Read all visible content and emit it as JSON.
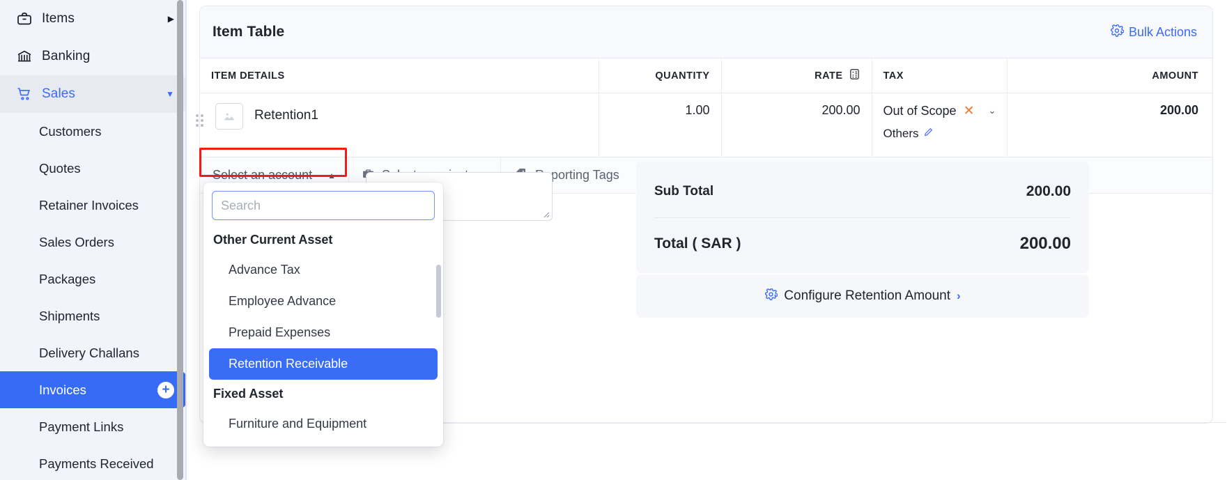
{
  "sidebar": {
    "top_items": [
      {
        "label": "Items",
        "icon": "briefcase-icon",
        "trailing": "caret-right"
      },
      {
        "label": "Banking",
        "icon": "bank-icon",
        "trailing": ""
      }
    ],
    "group": {
      "label": "Sales",
      "icon": "cart-icon",
      "trailing": "caret-down"
    },
    "sub_items": [
      {
        "label": "Customers",
        "selected": false
      },
      {
        "label": "Quotes",
        "selected": false
      },
      {
        "label": "Retainer Invoices",
        "selected": false
      },
      {
        "label": "Sales Orders",
        "selected": false
      },
      {
        "label": "Packages",
        "selected": false
      },
      {
        "label": "Shipments",
        "selected": false
      },
      {
        "label": "Delivery Challans",
        "selected": false
      },
      {
        "label": "Invoices",
        "selected": true,
        "badge": "+"
      },
      {
        "label": "Payment Links",
        "selected": false
      },
      {
        "label": "Payments Received",
        "selected": false
      }
    ]
  },
  "card": {
    "title": "Item Table",
    "bulk_actions": "Bulk Actions",
    "bulk_actions_icon": "gear-icon"
  },
  "table": {
    "headers": {
      "details": "ITEM DETAILS",
      "quantity": "QUANTITY",
      "rate": "RATE",
      "rate_icon": "calculator-icon",
      "tax": "TAX",
      "amount": "AMOUNT"
    },
    "rows": [
      {
        "name": "Retention1",
        "thumb_icon": "image-placeholder-icon",
        "quantity": "1.00",
        "rate": "200.00",
        "tax": "Out of Scope",
        "tax_clear_icon": "close-icon",
        "tax_caret_icon": "chevron-down-icon",
        "tax_sub": "Others",
        "tax_sub_icon": "pencil-icon",
        "amount": "200.00"
      }
    ]
  },
  "subbar": {
    "account": "Select an account",
    "account_caret": "caret-up",
    "project": "Select a project",
    "project_icon": "briefcase-icon",
    "project_caret": "caret-down",
    "tags": "Reporting Tags",
    "tags_icon": "tag-icon",
    "tags_caret": "caret-down"
  },
  "dropdown": {
    "search_placeholder": "Search",
    "search_value": "",
    "groups": [
      {
        "label": "Other Current Asset",
        "options": [
          {
            "label": "Advance Tax",
            "highlighted": false
          },
          {
            "label": "Employee Advance",
            "highlighted": false
          },
          {
            "label": "Prepaid Expenses",
            "highlighted": false
          },
          {
            "label": "Retention Receivable",
            "highlighted": true
          }
        ]
      },
      {
        "label": "Fixed Asset",
        "options": [
          {
            "label": "Furniture and Equipment",
            "highlighted": false
          }
        ]
      }
    ]
  },
  "totals": {
    "sub_total_label": "Sub Total",
    "sub_total_value": "200.00",
    "total_label": "Total ( SAR )",
    "total_value": "200.00"
  },
  "configure": {
    "label": "Configure Retention Amount",
    "icon": "gear-icon",
    "chevron": "›"
  },
  "colors": {
    "accent_blue": "#3b6af5",
    "selected_blue": "#356bf5",
    "highlight_red": "#f41b17",
    "tax_x_orange": "#ee7733",
    "sidebar_bg": "#f2f4fb",
    "panel_bg": "#f6f7fa"
  }
}
